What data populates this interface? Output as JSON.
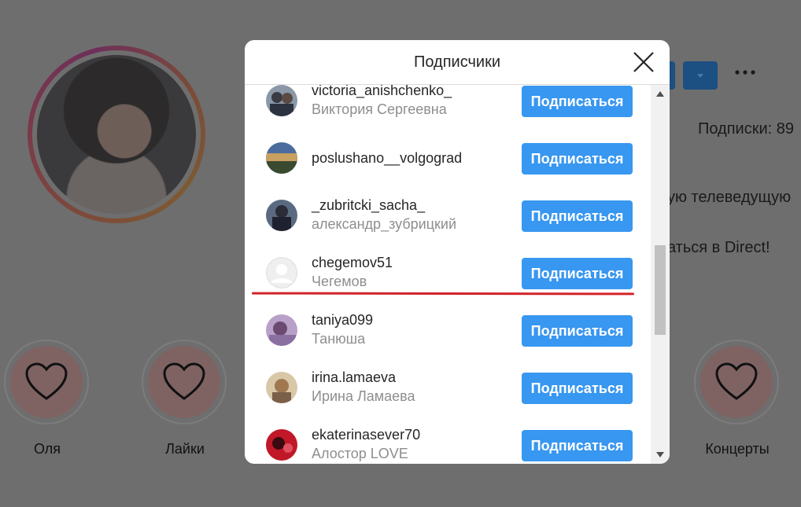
{
  "profile": {
    "following_label": "Подписки: 89",
    "bio_line1": "ую телеведущую",
    "bio_line2": "аться в Direct!",
    "more_icon": "more-horizontal-icon",
    "dropdown_icon": "chevron-down-icon"
  },
  "highlights": [
    {
      "label": "Оля",
      "icon": "heart-icon"
    },
    {
      "label": "Лайки",
      "icon": "heart-icon"
    },
    {
      "label": "Концерты",
      "icon": "heart-icon"
    }
  ],
  "modal": {
    "title": "Подписчики",
    "close_icon": "close-icon",
    "follow_label": "Подписаться",
    "accent": "#3897f0",
    "followers": [
      {
        "username": "victoria_anishchenko_",
        "fullname": "Виктория Сергеевна",
        "avatar": "photo-avatar"
      },
      {
        "username": "poslushano__volgograd",
        "fullname": "",
        "avatar": "photo-avatar"
      },
      {
        "username": "_zubritcki_sacha_",
        "fullname": "александр_зубрицкий",
        "avatar": "photo-avatar"
      },
      {
        "username": "chegemov51",
        "fullname": "Чегемов",
        "avatar": "default-avatar"
      },
      {
        "username": "taniya099",
        "fullname": "Танюша",
        "avatar": "photo-avatar"
      },
      {
        "username": "irina.lamaeva",
        "fullname": "Ирина Ламаева",
        "avatar": "photo-avatar"
      },
      {
        "username": "ekaterinasever70",
        "fullname": "Алостор LOVE",
        "avatar": "photo-avatar"
      }
    ]
  },
  "annotation_color": "#d2232a"
}
